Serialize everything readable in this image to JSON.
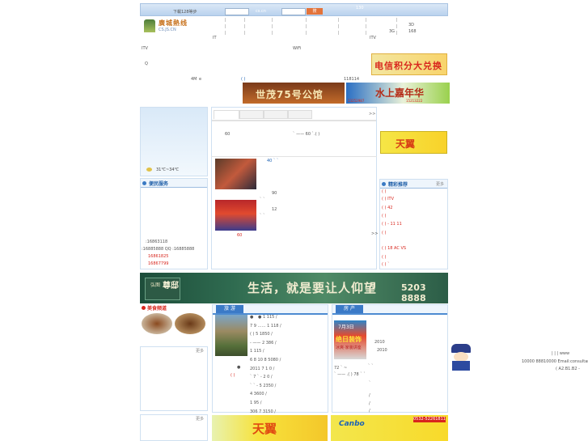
{
  "header": {
    "top_link": "下載128等步",
    "search_domain": "cs.cn",
    "count_text": "130",
    "logo_name": "廣城熱线",
    "logo_sub": "CS.JS.CN",
    "search_button": "搜",
    "nav_items": [
      "3D",
      "3G",
      "168",
      "IT",
      "ITV"
    ],
    "nav_itv": "ITV",
    "wifi": "WiFi",
    "q": "Q",
    "speed": "4M",
    "e": "e",
    "brackets": "( )",
    "phone_short": "118114"
  },
  "banners": {
    "telecom_points": "电信积分大兑换",
    "shimao": "世茂75号公馆",
    "blue_ad": "水上嘉年华",
    "blue_phone1": "13252987",
    "blue_phone2": "15213222"
  },
  "weather": {
    "temp": "31℃~34℃"
  },
  "services": {
    "title": "便民服务",
    "phone1": ":16863118",
    "qq_line": ":16885888 QQ :16885888",
    "red_phone1": "16861825",
    "red_phone2": "16867799"
  },
  "news": {
    "tabs": [
      "",
      "",
      "",
      ""
    ],
    "tab_more": ">>",
    "row_text1": "60",
    "row_text2": "`  ——  60       `.( )",
    "item_40": "40  `  `",
    "item_90": "90",
    "item_12": "12",
    "quote1": "`  `",
    "quote2": "`  `",
    "small_red": "60",
    "more": ">>"
  },
  "ads": {
    "tianyi": "天翼"
  },
  "recommend": {
    "title": "精彩推荐",
    "more": "更多",
    "items": [
      "(  )",
      "( ) ITV",
      "( )        42",
      "( )",
      "( )  -        11  11",
      "( )",
      "( )   18  AC  VS",
      "( )",
      "( )  `"
    ]
  },
  "big_banner": {
    "brand_small": "弘图",
    "brand_big": "尊邸",
    "slogan": "生活，就是要让人仰望",
    "phone": "5203 8888"
  },
  "food": {
    "title": "美食频道",
    "more": "更多"
  },
  "travel": {
    "label": "旅 游",
    "lines": [
      "●  `  ●             1      115   /",
      "7  9         ……  1      118   /",
      "( )          5     1850   /",
      "-     ——     2     386   /",
      "                    1      115   /",
      "6     8    10  8    5080   /",
      "  2011  7      1     0   /",
      "`  7  `   -       2     0   /",
      "   `  `  -      5    2350   /",
      "  4     3600   /",
      "                 1     95   /",
      "  306     7    3150   /"
    ],
    "dot": "●",
    "bracket": "( )"
  },
  "realestate": {
    "label": "房 产",
    "ad_date": "7月3日",
    "ad_title": "绝日装饰",
    "ad_sub": "冰爽·家装讲座",
    "lines": [
      "2010",
      "2010",
      "",
      "`  `",
      "72       `  ~",
      "         `  ——    .( )  78  `  `",
      "`",
      "",
      "/",
      "/",
      "/"
    ]
  },
  "bottom_ads": {
    "left": "天翼",
    "right_brand": "Canbo",
    "right_phone": "0532-52261811"
  },
  "footer_right": {
    "line1": "|   |     |    www",
    "line2": "10000     88810000  Email:consultant",
    "line3": "(        A2.B1.B2 -"
  }
}
